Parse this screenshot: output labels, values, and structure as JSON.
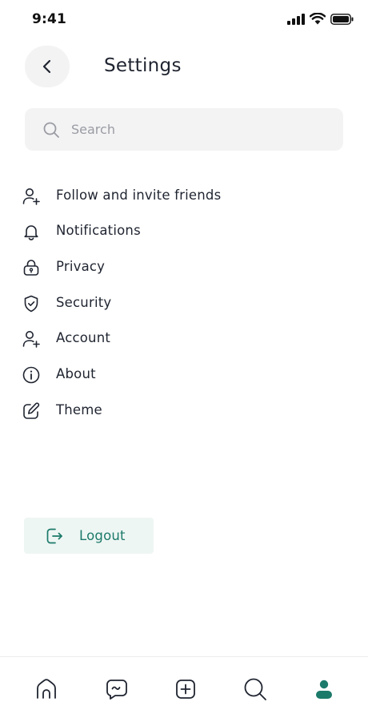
{
  "status_bar": {
    "time": "9:41",
    "icons": [
      "signal-icon",
      "wifi-icon",
      "battery-icon"
    ]
  },
  "header": {
    "title": "Settings",
    "back_icon": "chevron-left-icon"
  },
  "search": {
    "placeholder": "Search",
    "value": "",
    "icon": "search-icon"
  },
  "menu": {
    "items": [
      {
        "label": "Follow and invite friends",
        "icon": "user-add-icon"
      },
      {
        "label": "Notifications",
        "icon": "bell-icon"
      },
      {
        "label": "Privacy",
        "icon": "lock-icon"
      },
      {
        "label": "Security",
        "icon": "shield-check-icon"
      },
      {
        "label": "Account",
        "icon": "user-add-icon"
      },
      {
        "label": "About",
        "icon": "info-icon"
      },
      {
        "label": "Theme",
        "icon": "edit-icon"
      }
    ]
  },
  "logout": {
    "label": "Logout",
    "icon": "logout-icon"
  },
  "bottom_nav": {
    "items": [
      {
        "name": "home",
        "icon": "home-icon",
        "active": false
      },
      {
        "name": "messages",
        "icon": "chat-icon",
        "active": false
      },
      {
        "name": "create",
        "icon": "plus-square-icon",
        "active": false
      },
      {
        "name": "search",
        "icon": "search-icon",
        "active": false
      },
      {
        "name": "profile",
        "icon": "profile-icon",
        "active": true
      }
    ]
  },
  "colors": {
    "accent": "#1c7a6a",
    "accent_bg": "#eef6f3",
    "text": "#1f2430",
    "placeholder": "#9a9ca3",
    "field_bg": "#f3f3f4"
  }
}
